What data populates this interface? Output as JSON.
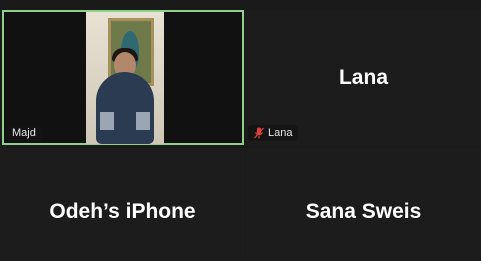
{
  "participants": [
    {
      "id": "majd",
      "name": "Majd",
      "has_video": true,
      "active_speaker": true
    },
    {
      "id": "lana",
      "name": "Lana",
      "center_label": "Lana",
      "muted": true
    },
    {
      "id": "odeh",
      "center_label": "Odeh’s iPhone"
    },
    {
      "id": "sana",
      "center_label": "Sana Sweis"
    }
  ],
  "colors": {
    "active_border": "#8fd18c",
    "muted_mic": "#e0403a",
    "background": "#1a1a1a"
  },
  "icons": {
    "muted_mic": "mic-muted-icon"
  }
}
